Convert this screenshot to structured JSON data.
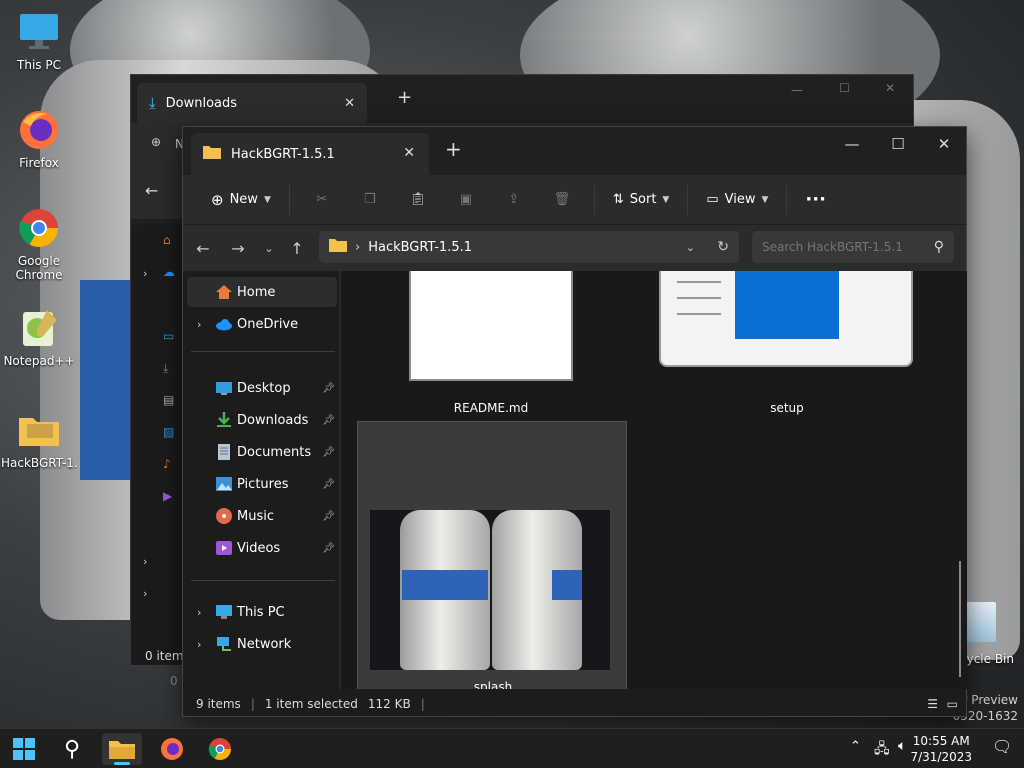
{
  "desktop": {
    "icons": [
      {
        "label": "This PC"
      },
      {
        "label": "Firefox"
      },
      {
        "label": "Google Chrome"
      },
      {
        "label": "Notepad++"
      },
      {
        "label": "HackBGRT-1..."
      }
    ],
    "recycle_bin_label": "cycle Bin",
    "watermark_line1": "er Preview",
    "watermark_line2": "0520-1632"
  },
  "back_window": {
    "tab_title": "Downloads",
    "nav_hint": "N",
    "status_text": "0 items",
    "status_text2": "0"
  },
  "window": {
    "tab_title": "HackBGRT-1.5.1",
    "toolbar": {
      "new_label": "New",
      "sort_label": "Sort",
      "view_label": "View",
      "more_label": "···"
    },
    "address": {
      "path": "HackBGRT-1.5.1"
    },
    "search": {
      "placeholder": "Search HackBGRT-1.5.1"
    },
    "nav": {
      "home": "Home",
      "onedrive": "OneDrive",
      "desktop": "Desktop",
      "downloads": "Downloads",
      "documents": "Documents",
      "pictures": "Pictures",
      "music": "Music",
      "videos": "Videos",
      "thispc": "This PC",
      "network": "Network"
    },
    "files": {
      "readme": "README.md",
      "setup": "setup",
      "splash": "splash"
    },
    "status": {
      "items": "9 items",
      "selected": "1 item selected",
      "size": "112 KB"
    }
  },
  "taskbar": {
    "time": "10:55 AM",
    "date": "7/31/2023"
  },
  "colors": {
    "accent_blue": "#0a6fd6",
    "folder_yellow": "#f2c14e",
    "dark_bg": "#1c1c1c"
  }
}
